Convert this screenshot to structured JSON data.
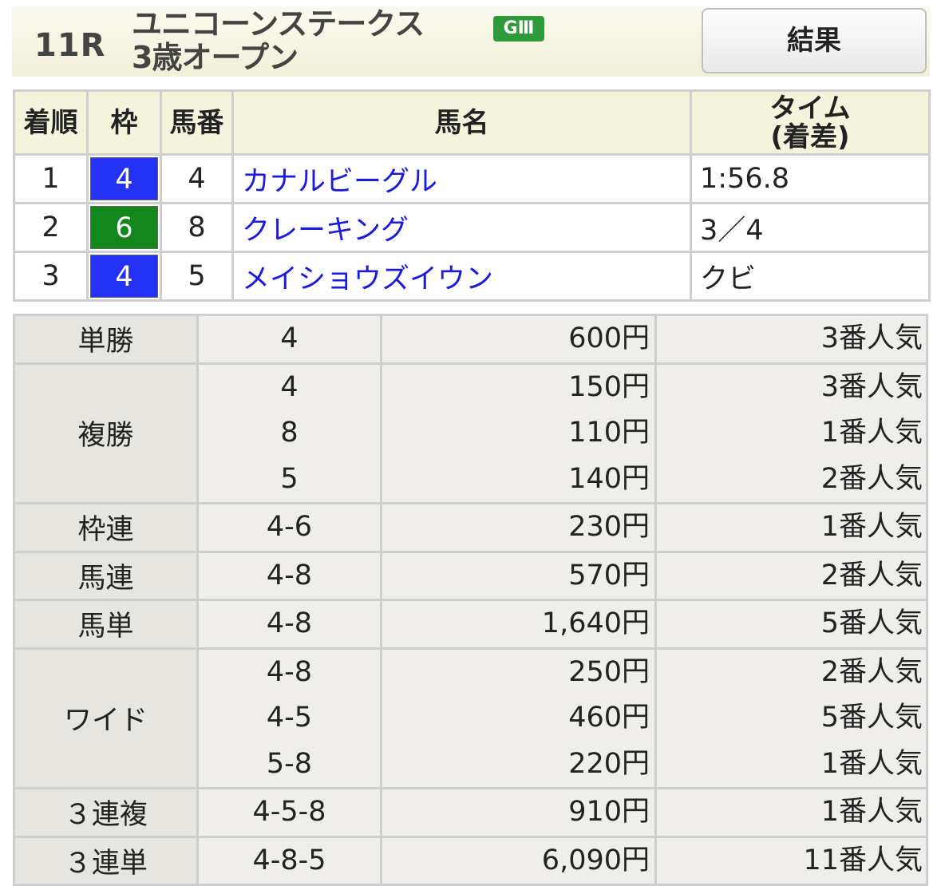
{
  "header": {
    "race_number": "11R",
    "race_name": "ユニコーンステークス",
    "race_class": "3歳オープン",
    "grade": "GⅢ",
    "result_button": "結果"
  },
  "results": {
    "headers": {
      "order": "着順",
      "frame": "枠",
      "number": "馬番",
      "horse": "馬名",
      "time_line1": "タイム",
      "time_line2": "(着差)"
    },
    "rows": [
      {
        "order": "1",
        "frame": "4",
        "frame_color": "#2432f5",
        "number": "4",
        "horse": "カナルビーグル",
        "time": "1:56.8"
      },
      {
        "order": "2",
        "frame": "6",
        "frame_color": "#12881c",
        "number": "8",
        "horse": "クレーキング",
        "time": "3／4"
      },
      {
        "order": "3",
        "frame": "4",
        "frame_color": "#2432f5",
        "number": "5",
        "horse": "メイショウズイウン",
        "time": "クビ"
      }
    ]
  },
  "payouts": [
    {
      "type": "単勝",
      "entries": [
        {
          "combo": "4",
          "amount": "600円",
          "popularity": "3番人気"
        }
      ]
    },
    {
      "type": "複勝",
      "entries": [
        {
          "combo": "4",
          "amount": "150円",
          "popularity": "3番人気"
        },
        {
          "combo": "8",
          "amount": "110円",
          "popularity": "1番人気"
        },
        {
          "combo": "5",
          "amount": "140円",
          "popularity": "2番人気"
        }
      ]
    },
    {
      "type": "枠連",
      "entries": [
        {
          "combo": "4-6",
          "amount": "230円",
          "popularity": "1番人気"
        }
      ]
    },
    {
      "type": "馬連",
      "entries": [
        {
          "combo": "4-8",
          "amount": "570円",
          "popularity": "2番人気"
        }
      ]
    },
    {
      "type": "馬単",
      "entries": [
        {
          "combo": "4-8",
          "amount": "1,640円",
          "popularity": "5番人気"
        }
      ]
    },
    {
      "type": "ワイド",
      "entries": [
        {
          "combo": "4-8",
          "amount": "250円",
          "popularity": "2番人気"
        },
        {
          "combo": "4-5",
          "amount": "460円",
          "popularity": "5番人気"
        },
        {
          "combo": "5-8",
          "amount": "220円",
          "popularity": "1番人気"
        }
      ]
    },
    {
      "type": "３連複",
      "entries": [
        {
          "combo": "4-5-8",
          "amount": "910円",
          "popularity": "1番人気"
        }
      ]
    },
    {
      "type": "３連単",
      "entries": [
        {
          "combo": "4-8-5",
          "amount": "6,090円",
          "popularity": "11番人気"
        }
      ]
    }
  ]
}
